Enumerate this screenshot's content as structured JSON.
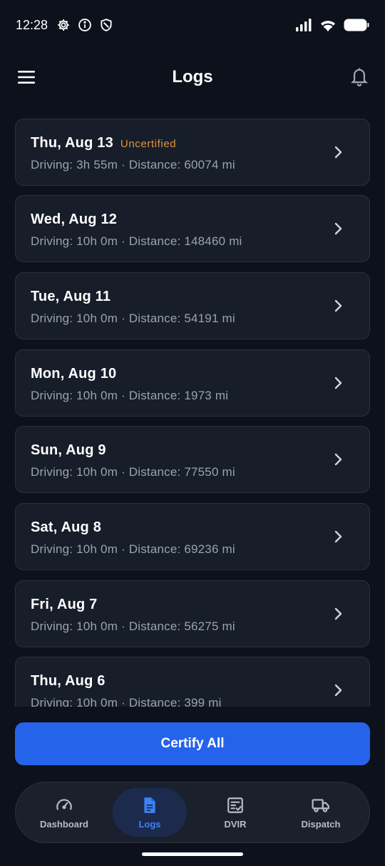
{
  "status_bar": {
    "time": "12:28",
    "left_icons": [
      "gear-icon",
      "info-icon",
      "shield-icon"
    ],
    "right_icons": [
      "signal-icon",
      "wifi-icon",
      "battery-icon"
    ]
  },
  "header": {
    "title": "Logs",
    "menu_icon": "hamburger-menu-icon",
    "notification_icon": "bell-icon"
  },
  "logs": [
    {
      "date": "Thu, Aug 13",
      "status": "Uncertified",
      "details": "Driving: 3h 55m · Distance: 60074 mi"
    },
    {
      "date": "Wed, Aug 12",
      "status": "",
      "details": "Driving: 10h 0m · Distance: 148460 mi"
    },
    {
      "date": "Tue, Aug 11",
      "status": "",
      "details": "Driving: 10h 0m · Distance: 54191 mi"
    },
    {
      "date": "Mon, Aug 10",
      "status": "",
      "details": "Driving: 10h 0m · Distance: 1973 mi"
    },
    {
      "date": "Sun, Aug 9",
      "status": "",
      "details": "Driving: 10h 0m · Distance: 77550 mi"
    },
    {
      "date": "Sat, Aug 8",
      "status": "",
      "details": "Driving: 10h 0m · Distance: 69236 mi"
    },
    {
      "date": "Fri, Aug 7",
      "status": "",
      "details": "Driving: 10h 0m · Distance: 56275 mi"
    },
    {
      "date": "Thu, Aug 6",
      "status": "",
      "details": "Driving: 10h 0m · Distance: 399 mi"
    }
  ],
  "actions": {
    "certify_all_label": "Certify All"
  },
  "bottom_nav": {
    "items": [
      {
        "label": "Dashboard",
        "icon": "speedometer-icon",
        "active": false
      },
      {
        "label": "Logs",
        "icon": "document-icon",
        "active": true
      },
      {
        "label": "DVIR",
        "icon": "checklist-icon",
        "active": false
      },
      {
        "label": "Dispatch",
        "icon": "truck-icon",
        "active": false
      }
    ]
  },
  "colors": {
    "background": "#0c111b",
    "card": "#171d29",
    "accent": "#2563eb",
    "uncertified": "#e0953a",
    "active_nav": "#3b82f6"
  }
}
